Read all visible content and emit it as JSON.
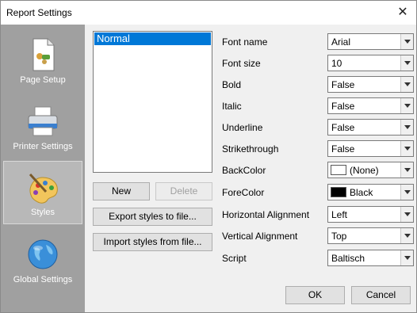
{
  "window": {
    "title": "Report Settings",
    "close_glyph": "✕"
  },
  "sidebar": {
    "items": [
      {
        "label": "Page Setup",
        "icon": "page-setup-icon",
        "selected": false
      },
      {
        "label": "Printer Settings",
        "icon": "printer-icon",
        "selected": false
      },
      {
        "label": "Styles",
        "icon": "palette-icon",
        "selected": true
      },
      {
        "label": "Global Settings",
        "icon": "globe-icon",
        "selected": false
      }
    ]
  },
  "styles_list": {
    "items": [
      "Normal"
    ],
    "selected": "Normal"
  },
  "buttons": {
    "new": "New",
    "delete": "Delete",
    "export": "Export styles to file...",
    "import": "Import styles from file...",
    "ok": "OK",
    "cancel": "Cancel"
  },
  "properties": [
    {
      "label": "Font name",
      "value": "Arial"
    },
    {
      "label": "Font size",
      "value": "10"
    },
    {
      "label": "Bold",
      "value": "False"
    },
    {
      "label": "Italic",
      "value": "False"
    },
    {
      "label": "Underline",
      "value": "False"
    },
    {
      "label": "Strikethrough",
      "value": "False"
    },
    {
      "label": "BackColor",
      "value": "(None)",
      "swatch": "#ffffff"
    },
    {
      "label": "ForeColor",
      "value": "Black",
      "swatch": "#000000"
    },
    {
      "label": "Horizontal Alignment",
      "value": "Left"
    },
    {
      "label": "Vertical Alignment",
      "value": "Top"
    },
    {
      "label": "Script",
      "value": "Baltisch"
    }
  ],
  "colors": {
    "selection": "#0078d7",
    "sidebar": "#a0a0a0"
  }
}
